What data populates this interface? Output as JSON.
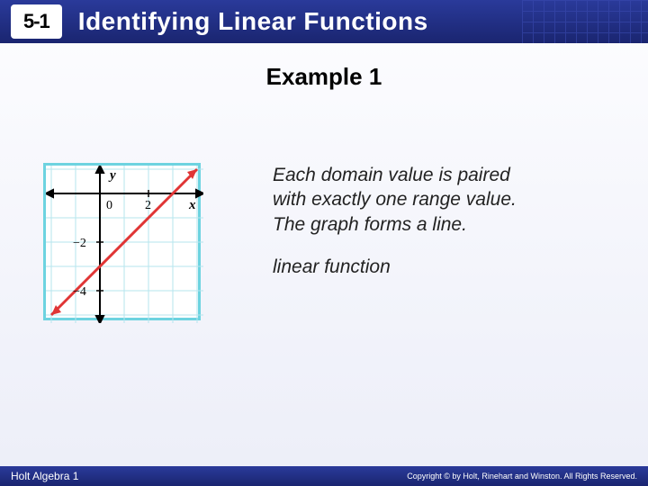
{
  "header": {
    "section": "5-1",
    "title": "Identifying Linear Functions"
  },
  "example_heading": "Example 1",
  "graph": {
    "x_label": "x",
    "y_label": "y",
    "tick_0": "0",
    "tick_2": "2",
    "tick_neg2": "−2",
    "tick_neg4": "−4"
  },
  "body": {
    "para1": "Each domain value is paired with exactly one range value. The graph forms a line.",
    "para2": "linear function"
  },
  "footer": {
    "left": "Holt Algebra 1",
    "right": "Copyright © by Holt, Rinehart and Winston. All Rights Reserved."
  },
  "chart_data": {
    "type": "line",
    "title": "",
    "xlabel": "x",
    "ylabel": "y",
    "xlim": [
      -2,
      4
    ],
    "ylim": [
      -5,
      1
    ],
    "series": [
      {
        "name": "line",
        "x": [
          -2,
          4
        ],
        "y": [
          -5,
          1
        ],
        "slope": 1,
        "intercept": -3
      }
    ],
    "x_ticks": [
      0,
      2
    ],
    "y_ticks": [
      -4,
      -2,
      0
    ]
  }
}
